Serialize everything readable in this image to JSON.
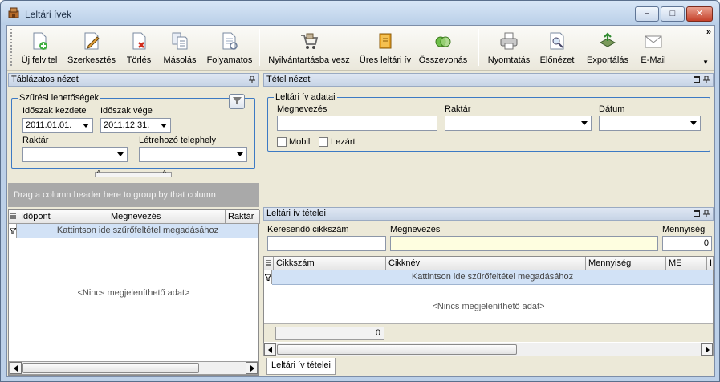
{
  "window": {
    "title": "Leltári ívek"
  },
  "toolbar": {
    "new": "Új felvitel",
    "edit": "Szerkesztés",
    "delete": "Törlés",
    "copy": "Másolás",
    "continuous": "Folyamatos",
    "register": "Nyilvántartásba vesz",
    "empty_sheet": "Üres leltári ív",
    "merge": "Összevonás",
    "print": "Nyomtatás",
    "preview": "Előnézet",
    "export": "Exportálás",
    "email": "E-Mail",
    "more": "»"
  },
  "left_panel": {
    "title": "Táblázatos nézet",
    "filter_group": "Szűrési lehetőségek",
    "period_start_label": "Időszak kezdete",
    "period_start_value": "2011.01.01.",
    "period_end_label": "Időszak vége",
    "period_end_value": "2011.12.31.",
    "warehouse_label": "Raktár",
    "site_label": "Létrehozó telephely",
    "group_hint": "Drag a column header here to group by that column",
    "columns": [
      "Időpont",
      "Megnevezés",
      "Raktár"
    ],
    "filter_hint": "Kattintson ide szűrőfeltétel megadásához",
    "empty": "<Nincs megjeleníthető adat>"
  },
  "item_panel": {
    "title": "Tétel nézet",
    "group": "Leltári ív adatai",
    "name_label": "Megnevezés",
    "warehouse_label": "Raktár",
    "date_label": "Dátum",
    "mobile_label": "Mobil",
    "closed_label": "Lezárt"
  },
  "lines_panel": {
    "title": "Leltári ív tételei",
    "search_label": "Keresendő cikkszám",
    "name_label": "Megnevezés",
    "qty_label": "Mennyiség",
    "qty_value": "0",
    "columns": [
      "Cikkszám",
      "Cikknév",
      "Mennyiség",
      "ME",
      "I"
    ],
    "filter_hint": "Kattintson ide szűrőfeltétel megadásához",
    "empty": "<Nincs megjeleníthető adat>",
    "summary_value": "0",
    "tab": "Leltári ív tételei"
  }
}
